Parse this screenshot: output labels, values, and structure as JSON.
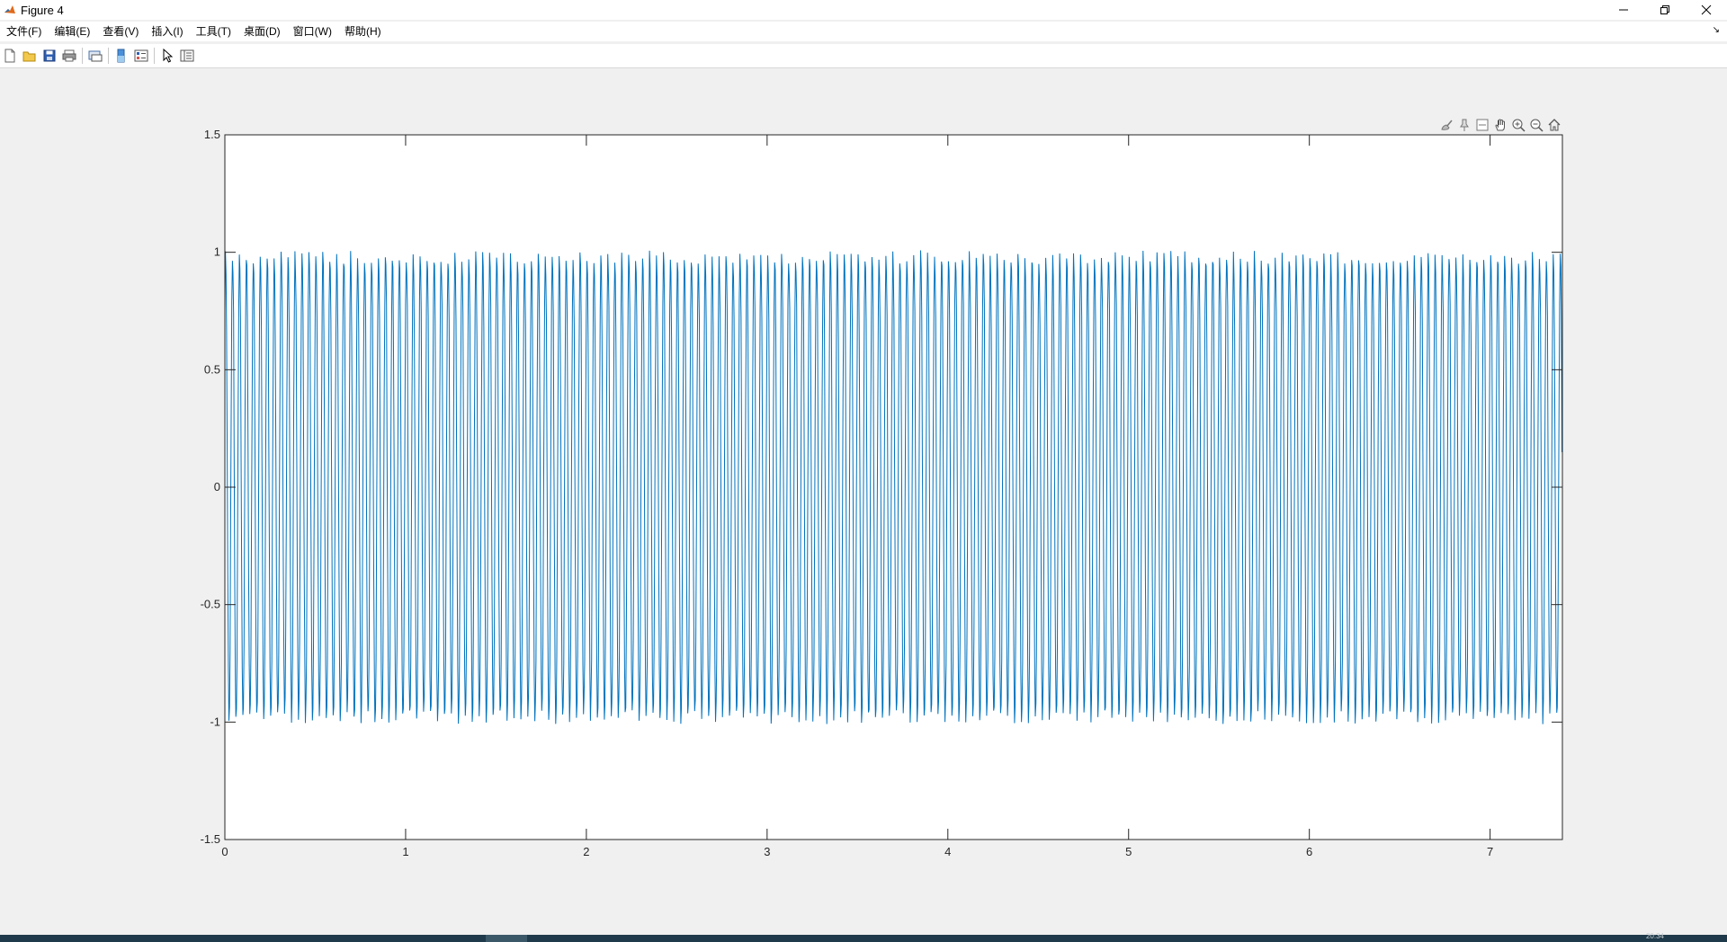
{
  "window": {
    "title": "Figure 4"
  },
  "menu": [
    "文件(F)",
    "编辑(E)",
    "查看(V)",
    "插入(I)",
    "工具(T)",
    "桌面(D)",
    "窗口(W)",
    "帮助(H)"
  ],
  "menu_corner": "↘",
  "toolbar": [
    "new-figure",
    "open-file",
    "save",
    "print",
    "separator",
    "print-preview",
    "separator",
    "colorbar",
    "legend",
    "separator",
    "edit-plot",
    "property-inspector"
  ],
  "axes_toolbar": [
    "brush",
    "data-cursor",
    "restore-view",
    "pan",
    "zoom-in",
    "zoom-out",
    "home"
  ],
  "taskbar": {
    "clock": "20:34"
  },
  "colors": {
    "line": "#0072bd",
    "background": "#f0f0f0",
    "axes": "#ffffff"
  },
  "chart_data": {
    "type": "line",
    "title": "",
    "xlabel": "",
    "ylabel": "",
    "xlim": [
      0,
      7.4
    ],
    "ylim": [
      -1.5,
      1.5
    ],
    "xticks": [
      "0",
      "1",
      "2",
      "3",
      "4",
      "5",
      "6",
      "7"
    ],
    "yticks": [
      "-1.5",
      "-1",
      "-0.5",
      "0",
      "0.5",
      "1",
      "1.5"
    ],
    "grid": false,
    "legend": "none",
    "series": [
      {
        "color": "#0072bd",
        "note_cycles_per_unit": 26,
        "peaks_approx": {
          "max": 1.3,
          "min": -1.26,
          "typical_high": 1.05,
          "typical_low": -1.05
        }
      }
    ]
  }
}
